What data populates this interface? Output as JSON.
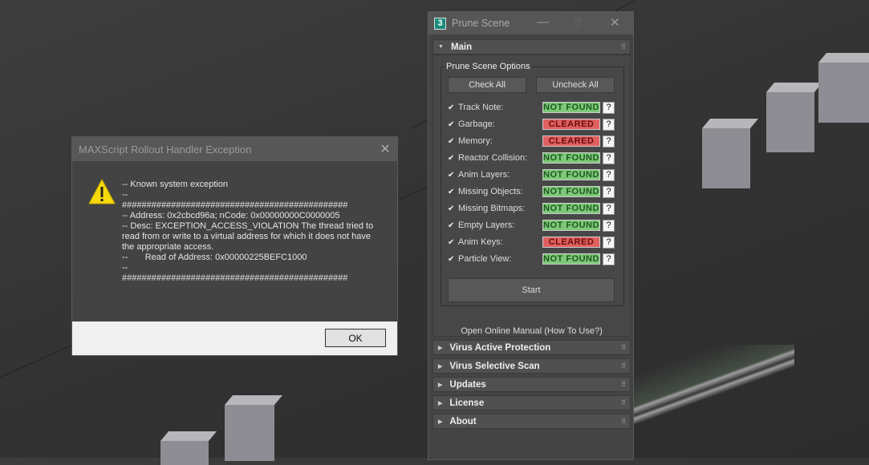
{
  "exception_dialog": {
    "title": "MAXScript Rollout Handler Exception",
    "message": "-- Known system exception\n--\n##############################################\n-- Address: 0x2cbcd96a; nCode: 0x00000000C0000005\n-- Desc: EXCEPTION_ACCESS_VIOLATION The thread tried to read from or write to a virtual address for which it does not have the appropriate access.\n--       Read of Address: 0x00000225BEFC1000\n--\n##############################################",
    "ok_label": "OK"
  },
  "prune_scene": {
    "title": "Prune Scene",
    "logo_text": "3",
    "main_rollout": "Main",
    "group_label": "Prune Scene Options",
    "check_all": "Check All",
    "uncheck_all": "Uncheck All",
    "options": [
      {
        "label": "Track Note:",
        "checked": true,
        "status": "NOT FOUND"
      },
      {
        "label": "Garbage:",
        "checked": true,
        "status": "CLEARED"
      },
      {
        "label": "Memory:",
        "checked": true,
        "status": "CLEARED"
      },
      {
        "label": "Reactor Collision:",
        "checked": true,
        "status": "NOT FOUND"
      },
      {
        "label": "Anim Layers:",
        "checked": true,
        "status": "NOT FOUND"
      },
      {
        "label": "Missing Objects:",
        "checked": true,
        "status": "NOT FOUND"
      },
      {
        "label": "Missing Bitmaps:",
        "checked": true,
        "status": "NOT FOUND"
      },
      {
        "label": "Empty Layers:",
        "checked": true,
        "status": "NOT FOUND"
      },
      {
        "label": "Anim Keys:",
        "checked": true,
        "status": "CLEARED"
      },
      {
        "label": "Particle View:",
        "checked": true,
        "status": "NOT FOUND"
      }
    ],
    "help_label": "?",
    "start_label": "Start",
    "manual_link": "Open Online Manual (How To Use?)",
    "rollouts": [
      "Virus Active Protection",
      "Virus Selective Scan",
      "Updates",
      "License",
      "About"
    ]
  },
  "colors": {
    "not_found": "#7ec87a",
    "cleared": "#e06060"
  }
}
